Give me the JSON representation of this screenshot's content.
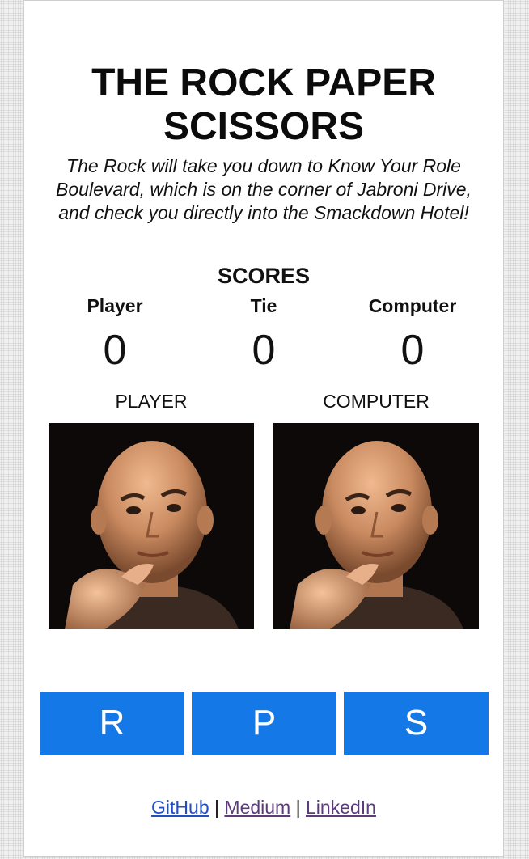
{
  "header": {
    "title_line1": "THE ROCK PAPER",
    "title_line2": "SCISSORS",
    "tagline_line1": "The Rock will take you down to Know Your Role",
    "tagline_line2": "Boulevard, which is on the corner of Jabroni Drive,",
    "tagline_line3": "and check you directly into the Smackdown Hotel!"
  },
  "scores": {
    "heading": "SCORES",
    "columns": [
      {
        "label": "Player",
        "value": "0"
      },
      {
        "label": "Tie",
        "value": "0"
      },
      {
        "label": "Computer",
        "value": "0"
      }
    ]
  },
  "choices": {
    "player_label": "PLAYER",
    "computer_label": "COMPUTER"
  },
  "buttons": {
    "rock": "R",
    "paper": "P",
    "scissors": "S",
    "color": "#1479e6"
  },
  "footer": {
    "github": "GitHub",
    "separator1": "|",
    "medium": "Medium",
    "separator2": "|",
    "linkedin": "LinkedIn"
  }
}
